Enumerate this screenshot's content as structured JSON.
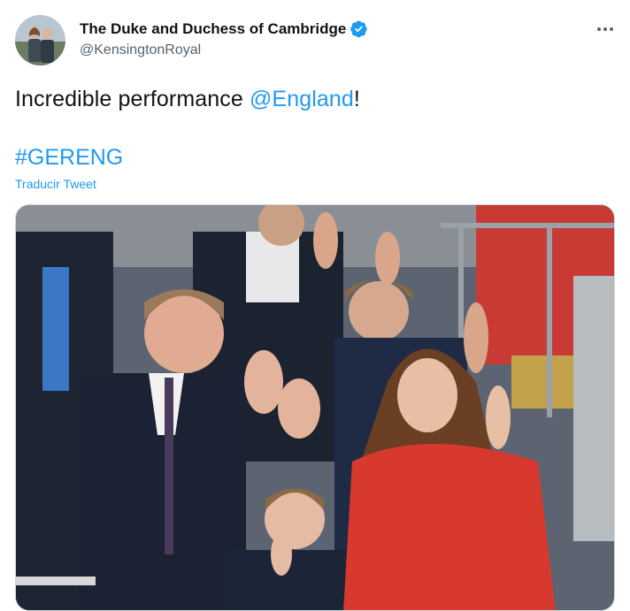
{
  "author": {
    "display_name": "The Duke and Duchess of Cambridge",
    "handle": "@KensingtonRoyal",
    "verified": true,
    "avatar_icon": "profile-photo"
  },
  "tweet": {
    "text_before": "Incredible performance ",
    "mention": "@England",
    "text_after": "!",
    "hashtag": "#GERENG",
    "translate_label": "Traducir Tweet"
  },
  "menu": {
    "more_icon": "more-horizontal-icon"
  },
  "media": {
    "type": "photo",
    "alt_icon": "tweet-photo"
  },
  "colors": {
    "accent": "#1d9bf0",
    "text": "#0f1419",
    "secondary": "#536471",
    "border": "#cfd9de"
  }
}
